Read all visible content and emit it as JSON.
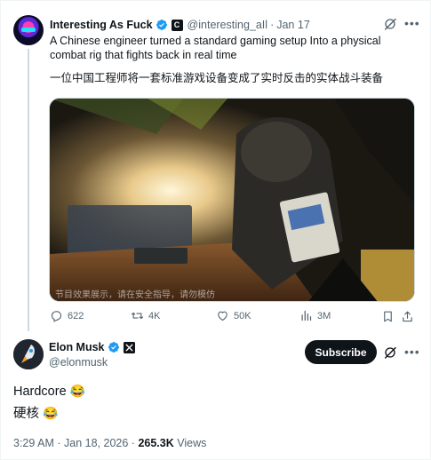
{
  "parent_tweet": {
    "author_name": "Interesting As Fuck",
    "affiliate_badge": "C",
    "handle": "@interesting_aIl",
    "separator": "·",
    "date": "Jan 17",
    "text_en": "A Chinese engineer turned a standard gaming setup Into a physical combat rig that fights back in real time",
    "text_zh": "一位中国工程师将一套标准游戏设备变成了实时反击的实体战斗装备",
    "media_caption": "节目效果展示，请在安全指导，请勿模仿",
    "metrics": {
      "replies": "622",
      "reposts": "4K",
      "likes": "50K",
      "views": "3M"
    },
    "icons": [
      "grok-icon",
      "more-icon",
      "reply-icon",
      "repost-icon",
      "like-icon",
      "views-icon",
      "bookmark-icon",
      "share-icon"
    ]
  },
  "reply_tweet": {
    "author_name": "Elon Musk",
    "handle": "@elonmusk",
    "subscribe_label": "Subscribe",
    "line1": "Hardcore",
    "line2": "硬核",
    "emoji": "😂",
    "time": "3:29 AM",
    "date": "Jan 18, 2026",
    "separator": "·",
    "views_count": "265.3K",
    "views_label": "Views"
  },
  "colors": {
    "text": "#0f1419",
    "muted": "#536471",
    "verified": "#1d9bf0",
    "border": "#cfd9de"
  }
}
